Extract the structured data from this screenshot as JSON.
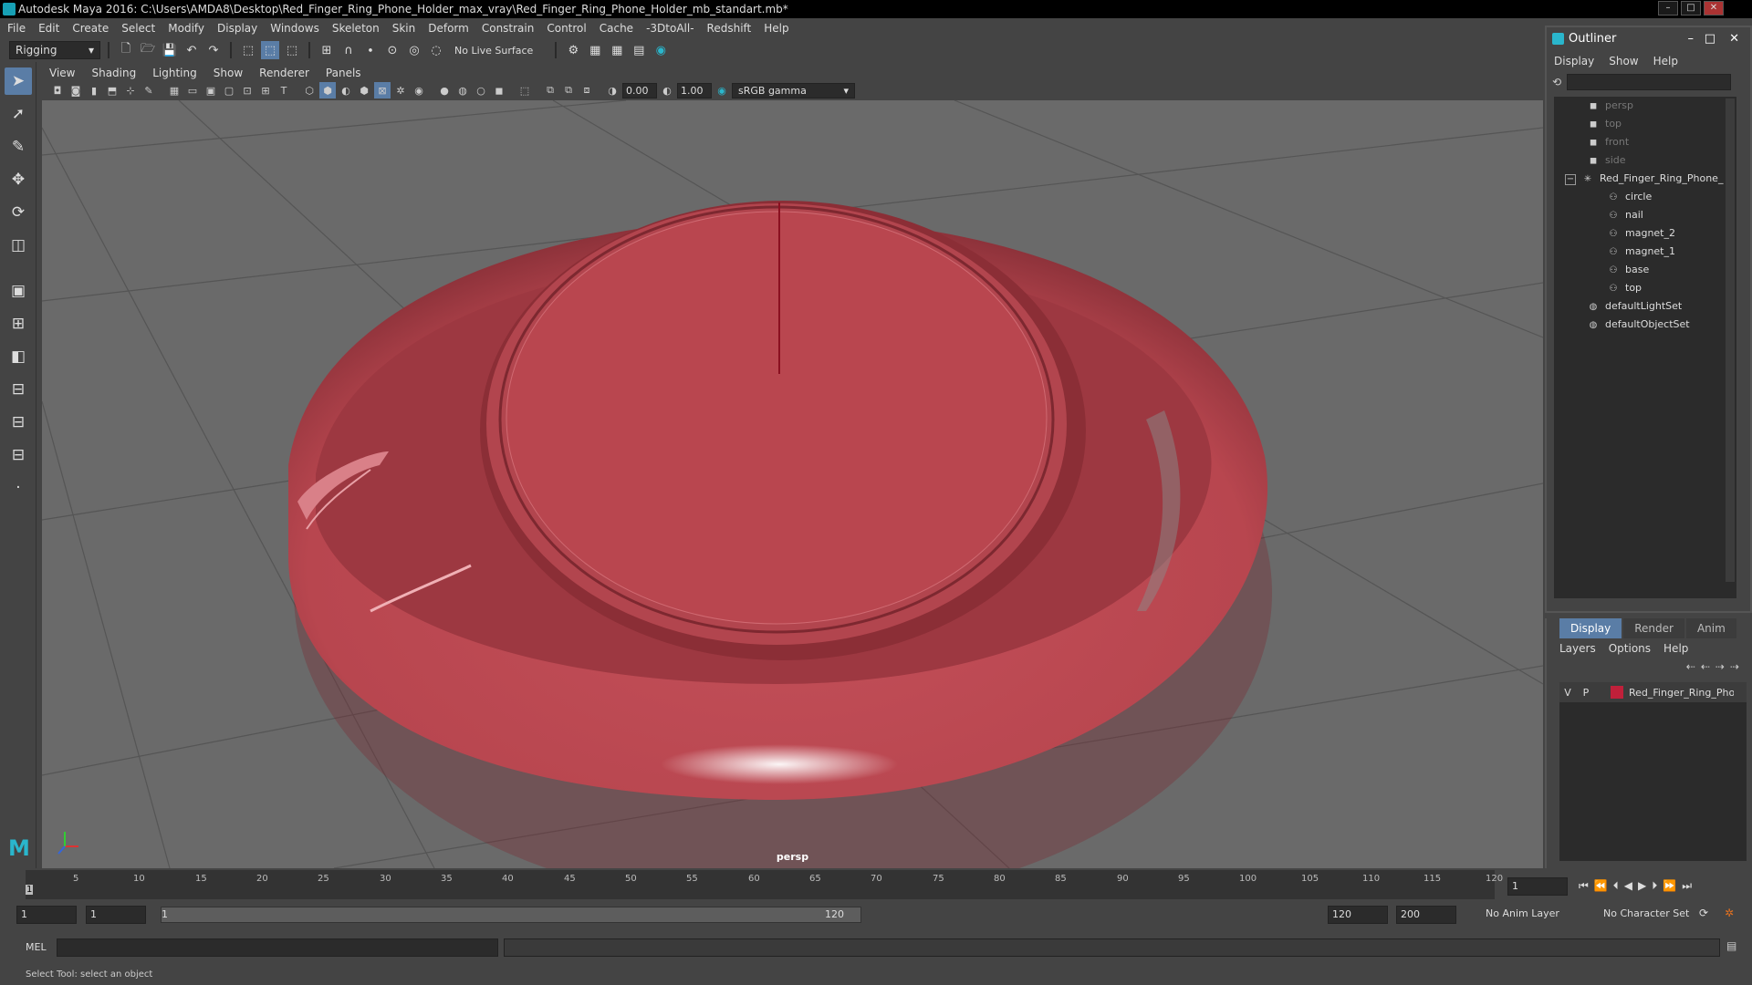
{
  "window": {
    "title": "Autodesk Maya 2016: C:\\Users\\AMDA8\\Desktop\\Red_Finger_Ring_Phone_Holder_max_vray\\Red_Finger_Ring_Phone_Holder_mb_standart.mb*",
    "minimize": "–",
    "restore": "□",
    "close": "✕"
  },
  "menubar": [
    "File",
    "Edit",
    "Create",
    "Select",
    "Modify",
    "Display",
    "Windows",
    "Skeleton",
    "Skin",
    "Deform",
    "Constrain",
    "Control",
    "Cache",
    "-3DtoAll-",
    "Redshift",
    "Help"
  ],
  "statusline": {
    "mode": "Rigging",
    "live_surface": "No Live Surface"
  },
  "panel": {
    "menu": [
      "View",
      "Shading",
      "Lighting",
      "Show",
      "Renderer",
      "Panels"
    ],
    "exposure": "0.00",
    "gamma": "1.00",
    "colorspace": "sRGB gamma",
    "camera_label": "persp"
  },
  "outliner": {
    "title": "Outliner",
    "menu": [
      "Display",
      "Show",
      "Help"
    ],
    "items": [
      {
        "label": "persp",
        "dim": true
      },
      {
        "label": "top",
        "dim": true
      },
      {
        "label": "front",
        "dim": true
      },
      {
        "label": "side",
        "dim": true
      },
      {
        "label": "Red_Finger_Ring_Phone_",
        "dim": false
      },
      {
        "label": "circle",
        "dim": false
      },
      {
        "label": "nail",
        "dim": false
      },
      {
        "label": "magnet_2",
        "dim": false
      },
      {
        "label": "magnet_1",
        "dim": false
      },
      {
        "label": "base",
        "dim": false
      },
      {
        "label": "top",
        "dim": false
      },
      {
        "label": "defaultLightSet",
        "dim": false
      },
      {
        "label": "defaultObjectSet",
        "dim": false
      }
    ]
  },
  "layers": {
    "tabs": [
      "Display",
      "Render",
      "Anim"
    ],
    "menu": [
      "Layers",
      "Options",
      "Help"
    ],
    "row": {
      "v": "V",
      "p": "P",
      "name": "Red_Finger_Ring_Phon",
      "color": "#c0203a"
    }
  },
  "timeline": {
    "ticks": [
      "5",
      "10",
      "15",
      "20",
      "25",
      "30",
      "35",
      "40",
      "45",
      "50",
      "55",
      "60",
      "65",
      "70",
      "75",
      "80",
      "85",
      "90",
      "95",
      "100",
      "105",
      "110",
      "115",
      "120"
    ],
    "current_marker": "1",
    "current_frame": "1"
  },
  "range": {
    "start": "1",
    "playback_start": "1",
    "slider_start": "1",
    "slider_end": "120",
    "playback_end": "120",
    "end": "200",
    "anim_layer": "No Anim Layer",
    "character_set": "No Character Set"
  },
  "command": {
    "label": "MEL"
  },
  "helpline": "Select Tool: select an object",
  "colors": {
    "object": "#b8464f",
    "accent": "#5a7da6"
  }
}
